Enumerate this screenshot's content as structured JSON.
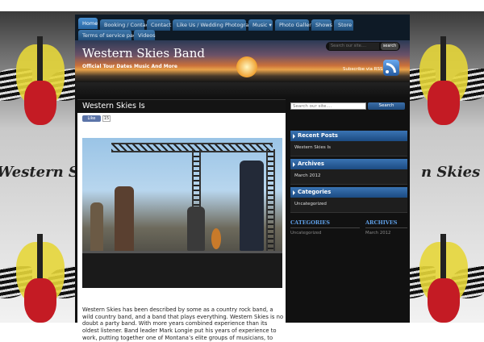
{
  "nav": {
    "row1": [
      "Home",
      "Booking / Contact",
      "Contact",
      "Like Us / Wedding Photography",
      "Music ▾",
      "Photo Gallery",
      "Shows",
      "Store"
    ],
    "row2": [
      "Terms of service page",
      "Videos"
    ]
  },
  "header": {
    "title": "Western Skies Band",
    "tagline": "Official Tour Dates Music And More",
    "search_placeholder": "Search our site....",
    "search_button": "search",
    "rss_label": "Subscribe via RSS"
  },
  "background": {
    "text_left": "Western S",
    "text_right": "n Skies"
  },
  "post": {
    "title": "Western Skies Is",
    "like_label": "Like",
    "like_count": "15",
    "body": "Western Skies has been described by some as a country rock band, a wild country band, and a band that plays everything. Western Skies is no doubt a party band. With more years combined experience than its oldest listener. Band leader Mark Longie put his years of experience to work, putting together one of Montana’s elite groups of musicians, to"
  },
  "sidebar": {
    "search_placeholder": "Search our site....",
    "search_button": "Search",
    "widgets": [
      {
        "title": "Recent Posts",
        "link": "Western Skies Is"
      },
      {
        "title": "Archives",
        "link": "March 2012"
      },
      {
        "title": "Categories",
        "link": "Uncategorized"
      }
    ],
    "footer": [
      {
        "title": "CATEGORIES",
        "link": "Uncategorized"
      },
      {
        "title": "ARCHIVES",
        "link": "March 2012"
      }
    ]
  },
  "colors": {
    "nav_tab": "#2766a3",
    "widget_header": "#1c4b82",
    "footer_heading": "#5fa0e8"
  }
}
